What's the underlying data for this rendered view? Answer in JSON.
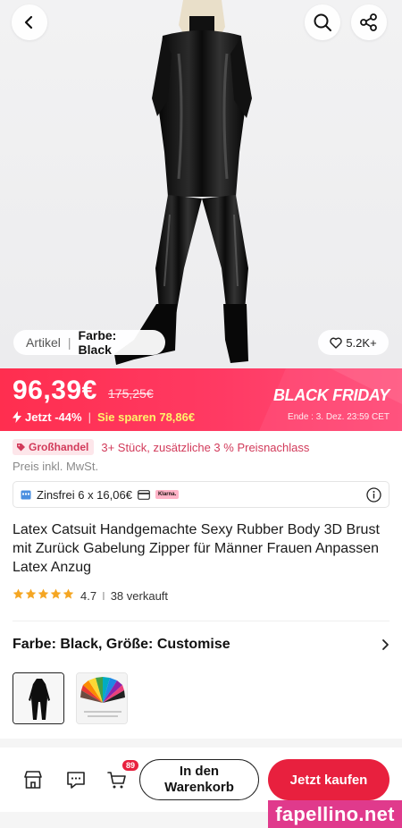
{
  "hero": {
    "tab_artikel": "Artikel",
    "tab_separator": "|",
    "tab_farbe": "Farbe: Black",
    "likes": "5.2K+"
  },
  "price": {
    "current": "96,39€",
    "original": "175,25€",
    "discount": "Jetzt -44%",
    "savings": "Sie sparen 78,86€",
    "event_label": "BLACK FRIDAY",
    "event_end": "Ende : 3. Dez. 23:59 CET"
  },
  "wholesale": {
    "badge": "Großhandel",
    "text": "3+ Stück, zusätzliche 3 % Preisnachlass"
  },
  "tax_note": "Preis inkl. MwSt.",
  "installment": {
    "text": "Zinsfrei 6 x 16,06€",
    "provider": "Klarna."
  },
  "product": {
    "title": "Latex Catsuit Handgemachte Sexy Rubber Body 3D Brust mit Zurück Gabelung Zipper für Männer Frauen Anpassen Latex Anzug",
    "rating": "4.7",
    "rating_divider": "I",
    "sold": "38 verkauft"
  },
  "variant": {
    "label": "Farbe: Black, Größe: Customise"
  },
  "bottom_bar": {
    "cart_count": "89",
    "add_to_cart": "In den Warenkorb",
    "buy_now": "Jetzt kaufen"
  },
  "watermark": "fapellino.net",
  "colors": {
    "accent": "#e8203e",
    "banner_start": "#ff2e4f",
    "banner_end": "#ff4f7a",
    "savings_yellow": "#fff36b",
    "wholesale_pink": "#d23a5a",
    "star": "#f5a623",
    "watermark": "#e03a8c"
  },
  "icons": [
    "back-icon",
    "search-icon",
    "share-icon",
    "heart-icon",
    "bolt-icon",
    "tag-icon",
    "calendar-icon",
    "card-icon",
    "info-icon",
    "star-icon",
    "chevron-right-icon",
    "store-icon",
    "chat-icon",
    "cart-icon"
  ]
}
